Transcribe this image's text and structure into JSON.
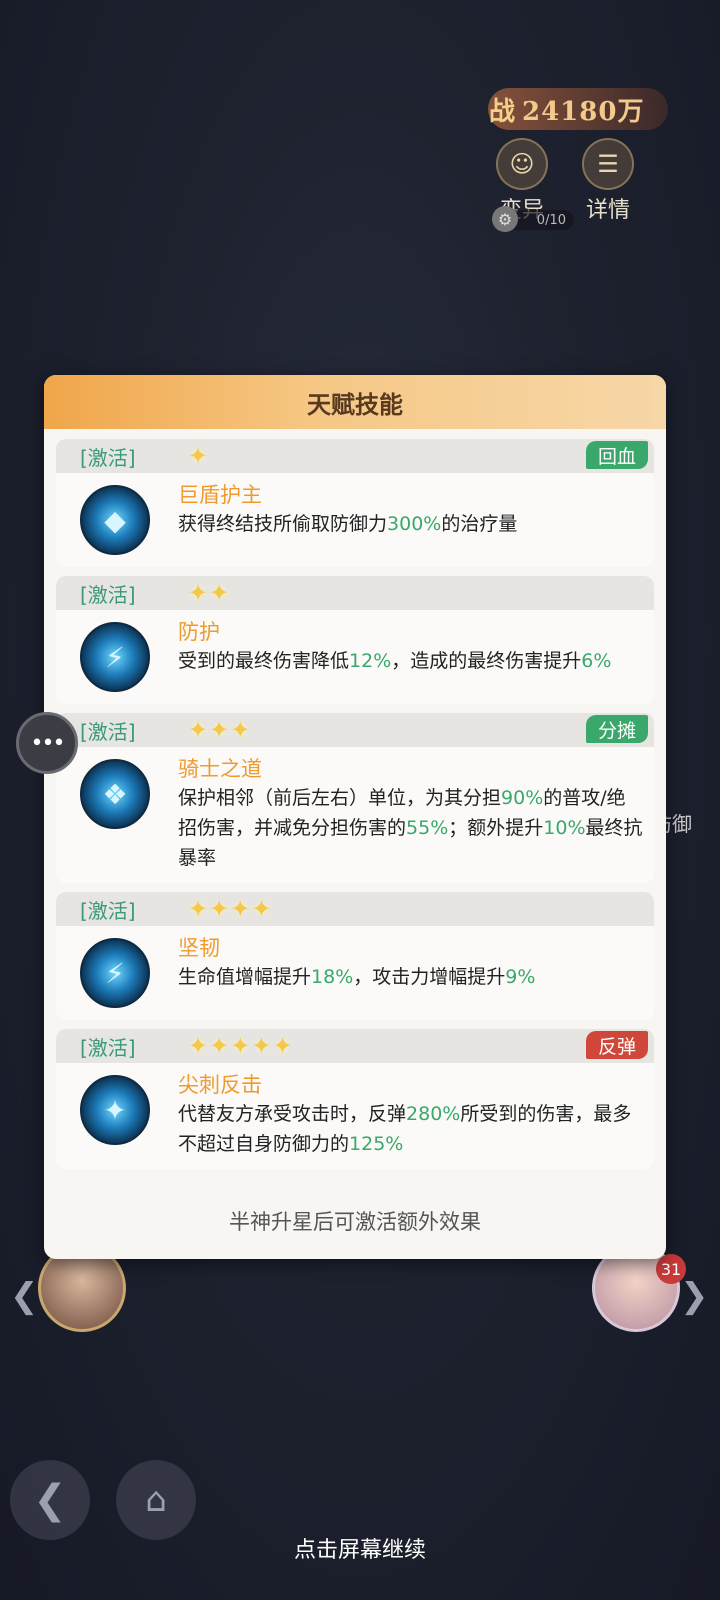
{
  "top": {
    "power_label": "战",
    "power_value": "24180万",
    "mutate_label": "变异",
    "details_label": "详情",
    "mutate_progress": "0/10"
  },
  "side": {
    "defense_label": "防御",
    "friend_badge": "31"
  },
  "panel": {
    "title": "天赋技能",
    "footer": "半神升星后可激活额外效果"
  },
  "skills": [
    {
      "status": "[激活]",
      "stars": 1,
      "tag": "回血",
      "tag_color": "#3aa86a",
      "name": "巨盾护主",
      "desc_parts": [
        "获得终结技所偷取防御力",
        "300%",
        "的治疗量"
      ]
    },
    {
      "status": "[激活]",
      "stars": 2,
      "tag": "",
      "name": "防护",
      "desc_parts": [
        "受到的最终伤害降低",
        "12%",
        "，造成的最终伤害提升",
        "6%",
        ""
      ]
    },
    {
      "status": "[激活]",
      "stars": 3,
      "tag": "分摊",
      "tag_color": "#3aa86a",
      "name": "骑士之道",
      "desc_parts": [
        "保护相邻（前后左右）单位，为其分担",
        "90%",
        "的普攻/绝招伤害，并减免分担伤害的",
        "55%",
        "；额外提升",
        "10%",
        "最终抗暴率"
      ]
    },
    {
      "status": "[激活]",
      "stars": 4,
      "tag": "",
      "name": "坚韧",
      "desc_parts": [
        "生命值增幅提升",
        "18%",
        "，攻击力增幅提升",
        "9%",
        ""
      ]
    },
    {
      "status": "[激活]",
      "stars": 5,
      "tag": "反弹",
      "tag_color": "#d0473a",
      "name": "尖刺反击",
      "desc_parts": [
        "代替友方承受攻击时，反弹",
        "280%",
        "所受到的伤害，最多不超过自身防御力的",
        "125%",
        ""
      ]
    }
  ],
  "bottom": {
    "continue_hint": "点击屏幕继续"
  },
  "colors": {
    "accent_orange": "#f09a2e",
    "highlight_green": "#3aa86a",
    "status_green": "#3a9a78"
  }
}
